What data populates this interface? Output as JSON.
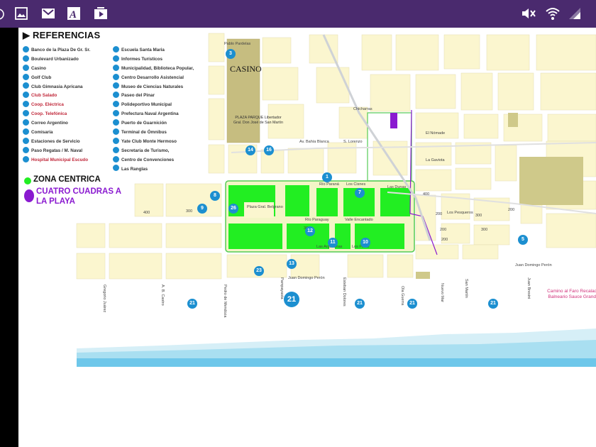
{
  "status_bar": {
    "background": "#4a2a6e",
    "left_icons": [
      "image-icon",
      "mail-icon",
      "font-icon",
      "play-icon"
    ],
    "right_icons": [
      "volume-muted-icon",
      "wifi-icon",
      "signal-icon"
    ]
  },
  "map": {
    "references_title": "REFERENCIAS",
    "references_col1": [
      {
        "label": "Banco de la Plaza De Gr. Sr."
      },
      {
        "label": "Boulevard Urbanizado"
      },
      {
        "label": "Casino"
      },
      {
        "label": "Golf Club"
      },
      {
        "label": "Club Gimnasia Apricana"
      },
      {
        "label": "Club Salado",
        "highlight": true
      },
      {
        "label": "Coop. Eléctrica",
        "highlight": true
      },
      {
        "label": "Coop. Telefónica",
        "highlight": true
      },
      {
        "label": "Correo Argentino"
      },
      {
        "label": "Comisaría"
      },
      {
        "label": "Estaciones de Servicio"
      },
      {
        "label": "Paso Regatas / M. Naval"
      },
      {
        "label": "Hospital Municipal Escudo",
        "highlight": true
      }
    ],
    "references_col2": [
      {
        "label": "Escuela Santa Maria"
      },
      {
        "label": "Informes Turísticos"
      },
      {
        "label": "Municipalidad, Biblioteca Popular,"
      },
      {
        "label": "Centro Desarrollo Asistencial"
      },
      {
        "label": "Museo de Ciencias Naturales"
      },
      {
        "label": "Paseo del Pinar"
      },
      {
        "label": "Polideportivo Municipal"
      },
      {
        "label": "Prefectura Naval Argentina"
      },
      {
        "label": "Puerto de Guarnición"
      },
      {
        "label": "Terminal de Ómnibus"
      },
      {
        "label": "Yate Club Monte Hermoso"
      },
      {
        "label": "Secretaría de Turismo,"
      },
      {
        "label": "Centro de Convenciones"
      },
      {
        "label": "Las Ranglas"
      }
    ],
    "legend": [
      {
        "label": "ZONA CENTRICA",
        "color": "#22ee22"
      },
      {
        "label": "CUATRO CUADRAS A",
        "label2": "LA PLAYA",
        "color": "#8a1ad0"
      }
    ],
    "casino_label": "CASINO",
    "plaza_label": "PLAZA PARQUE Libertador Gral. Don José de San Martín",
    "plaza_small_label": "Plaza Gral. Belgrano",
    "street_labels": {
      "pablo_pardelas": "Pablo Pardelas",
      "chicharras": "Chicharras",
      "av_bahia_blanca": "Av. Bahía Blanca",
      "san_lorenzo": "S. Lorenzo",
      "rio_parana": "Río Paraná",
      "los_cisnes": "Los Cisnes",
      "las_dunas": "Las Dunas",
      "rio_paraguay": "Río Paraguay",
      "valle_encantado": "Valle Encantado",
      "las_argentinas": "Las Argentinas",
      "los_pinos": "Los Pinos",
      "juan_domingo_peron": "Juan Domingo Perón",
      "los_pesqueros": "Los Pesqueros",
      "el_nomade": "El Nómade",
      "la_gaviota": "La Gaviota"
    },
    "block_numbers": [
      "400",
      "300",
      "400",
      "200",
      "300",
      "200",
      "300",
      "200",
      "200",
      "300"
    ],
    "vertical_streets": [
      "Gregorio Juárez",
      "A. B. Castro",
      "Pedro de Mendoza",
      "Pampayasta",
      "Esteban Dolores",
      "Ola Guerra",
      "Nuevo Mar",
      "San Martín",
      "Juan Bresini"
    ],
    "side_note": "Camino al Faro Recalada Balneario Sauce Grande",
    "pins": [
      "3",
      "14",
      "16",
      "1",
      "7",
      "8",
      "9",
      "26",
      "12",
      "13",
      "11",
      "10",
      "5",
      "23",
      "21",
      "21",
      "21",
      "21",
      "21"
    ],
    "colors": {
      "zona_centrica": "#22ee22",
      "cuatro_cuadras": "#8a1ad0",
      "block": "#fbf6cf",
      "street": "#ffffff",
      "park": "#c6bd80",
      "sea": "#7ed0ec",
      "pin": "#1c8fd0"
    }
  }
}
